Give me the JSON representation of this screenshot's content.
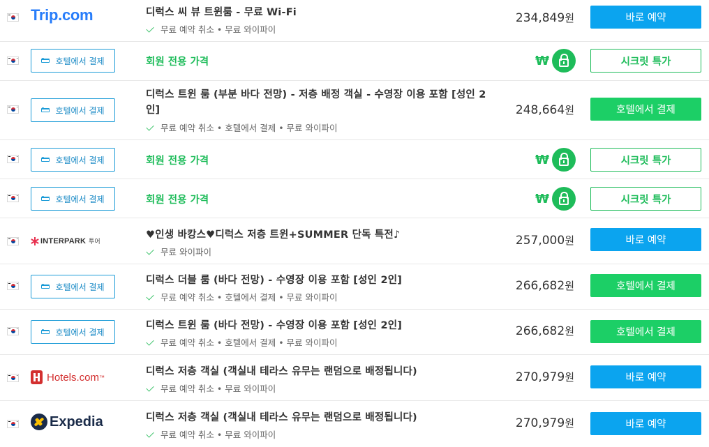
{
  "colors": {
    "blue_button": "#0ba4ef",
    "green_button": "#1ccf66",
    "member_green": "#1ebc5a",
    "check_green": "#3cc36a",
    "hotel_pay_border": "#1b9bd7"
  },
  "common": {
    "hotel_pay_label": "호텔에서 결제",
    "member_price_label": "회원 전용 가격",
    "won_sign": "₩",
    "secret_button": "시크릿 특가",
    "book_button": "바로 예약",
    "hotel_pay_button": "호텔에서 결제",
    "currency_unit": "원"
  },
  "rows": [
    {
      "provider": "Trip.com",
      "provider_icon": "trip-com-logo",
      "title": "디럭스 씨 뷰 트윈룸 - 무료 Wi-Fi",
      "features": "무료 예약 취소 • 무료 와이파이",
      "price": "234,849",
      "button": "바로 예약",
      "button_style": "blue"
    },
    {
      "provider": "호텔에서 결제",
      "provider_icon": "bed-icon",
      "title": "회원 전용 가격",
      "price_icon": "lock-icon",
      "button": "시크릿 특가",
      "button_style": "secret"
    },
    {
      "provider": "호텔에서 결제",
      "provider_icon": "bed-icon",
      "title": "디럭스 트윈 룸 (부분 바다 전망) - 저층 배정 객실 - 수영장 이용 포함 [성인 2인]",
      "features": "무료 예약 취소 • 호텔에서 결제 • 무료 와이파이",
      "price": "248,664",
      "button": "호텔에서 결제",
      "button_style": "green"
    },
    {
      "provider": "호텔에서 결제",
      "provider_icon": "bed-icon",
      "title": "회원 전용 가격",
      "price_icon": "lock-icon",
      "button": "시크릿 특가",
      "button_style": "secret"
    },
    {
      "provider": "호텔에서 결제",
      "provider_icon": "bed-icon",
      "title": "회원 전용 가격",
      "price_icon": "lock-icon",
      "button": "시크릿 특가",
      "button_style": "secret"
    },
    {
      "provider": "INTERPARK",
      "provider_sub": "투어",
      "provider_icon": "interpark-logo",
      "title": "♥인생 바캉스♥디럭스 저층 트윈+SUMMER 단독 특전♪",
      "features": "무료 와이파이",
      "price": "257,000",
      "button": "바로 예약",
      "button_style": "blue"
    },
    {
      "provider": "호텔에서 결제",
      "provider_icon": "bed-icon",
      "title": "디럭스 더블 룸 (바다 전망) - 수영장 이용 포함 [성인 2인]",
      "features": "무료 예약 취소 • 호텔에서 결제 • 무료 와이파이",
      "price": "266,682",
      "button": "호텔에서 결제",
      "button_style": "green"
    },
    {
      "provider": "호텔에서 결제",
      "provider_icon": "bed-icon",
      "title": "디럭스 트윈 룸 (바다 전망) - 수영장 이용 포함 [성인 2인]",
      "features": "무료 예약 취소 • 호텔에서 결제 • 무료 와이파이",
      "price": "266,682",
      "button": "호텔에서 결제",
      "button_style": "green"
    },
    {
      "provider": "Hotels.com",
      "provider_tm": "™",
      "provider_icon": "hotels-com-logo",
      "title": "디럭스 저층 객실 (객실내 테라스 유무는 랜덤으로 배정됩니다)",
      "features": "무료 예약 취소 • 무료 와이파이",
      "price": "270,979",
      "button": "바로 예약",
      "button_style": "blue"
    },
    {
      "provider": "Expedia",
      "provider_icon": "expedia-logo",
      "title": "디럭스 저층 객실 (객실내 테라스 유무는 랜덤으로 배정됩니다)",
      "features": "무료 예약 취소 • 무료 와이파이",
      "price": "270,979",
      "button": "바로 예약",
      "button_style": "blue"
    }
  ]
}
